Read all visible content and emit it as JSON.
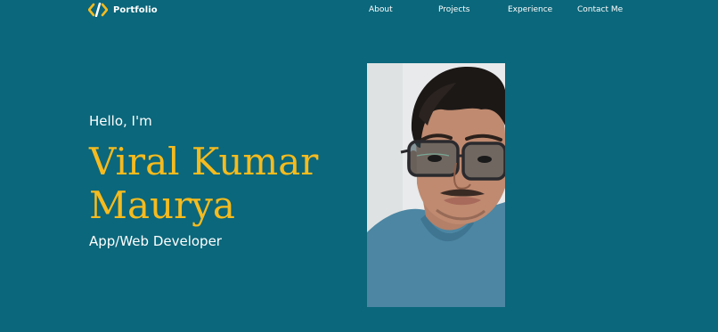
{
  "brand": {
    "logo_glyph": "code-brackets-icon",
    "name": "Portfolio",
    "accent_color": "#f6bb1e"
  },
  "nav": {
    "items": [
      {
        "label": "About"
      },
      {
        "label": "Projects"
      },
      {
        "label": "Experience"
      },
      {
        "label": "Contact Me"
      }
    ]
  },
  "hero": {
    "greeting": "Hello, I'm",
    "name_line1": "Viral Kumar",
    "name_line2": "Maurya",
    "role": "App/Web Developer",
    "background_color": "#0b677b",
    "photo_alt": "profile-photo"
  }
}
